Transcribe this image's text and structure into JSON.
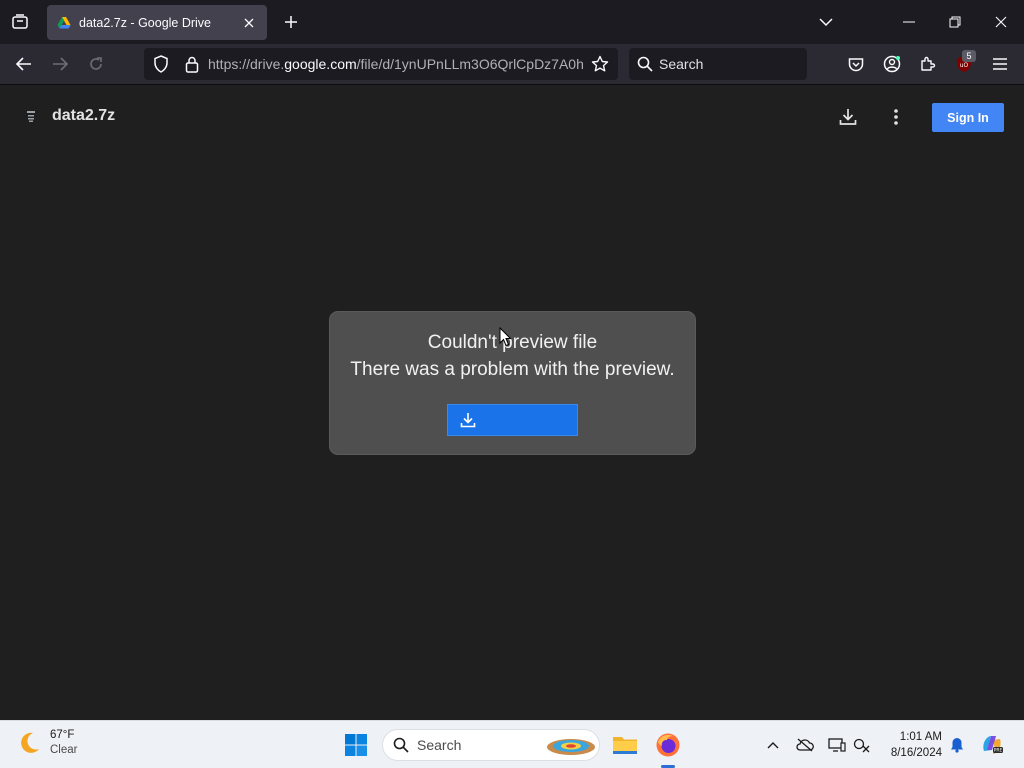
{
  "browser": {
    "tab": {
      "title": "data2.7z - Google Drive"
    },
    "address_bar": {
      "url_prefix": "https://drive.",
      "url_domain": "google.com",
      "url_path": "/file/d/1ynUPnLLm3O6QrlCpDz7A0h"
    },
    "search": {
      "placeholder": "Search"
    },
    "extension_badge": "5",
    "icons": {
      "tab_list": "tab-list-icon",
      "new_tab": "plus-icon",
      "list_all_tabs": "chevron-down-icon",
      "minimize": "minimize-icon",
      "restore": "restore-icon",
      "close": "close-icon",
      "back": "arrow-left-icon",
      "forward": "arrow-right-icon",
      "reload": "reload-icon",
      "shield": "shield-icon",
      "lock": "lock-icon",
      "bookmark": "star-icon",
      "pocket": "pocket-icon",
      "account": "account-icon",
      "extensions": "puzzle-icon",
      "ublock": "ublock-icon",
      "menu": "hamburger-icon"
    }
  },
  "page": {
    "file_name": "data2.7z",
    "sign_in_label": "Sign In",
    "dialog": {
      "title": "Couldn't preview file",
      "message": "There was a problem with the preview."
    }
  },
  "taskbar": {
    "weather": {
      "temperature": "67°F",
      "condition": "Clear"
    },
    "search_label": "Search",
    "clock": {
      "time": "1:01 AM",
      "date": "8/16/2024"
    }
  },
  "colors": {
    "accent_blue": "#4285f4",
    "download_button": "#1a73e8",
    "dialog_bg": "#4f4f4f",
    "page_bg": "#1f1f1f"
  }
}
